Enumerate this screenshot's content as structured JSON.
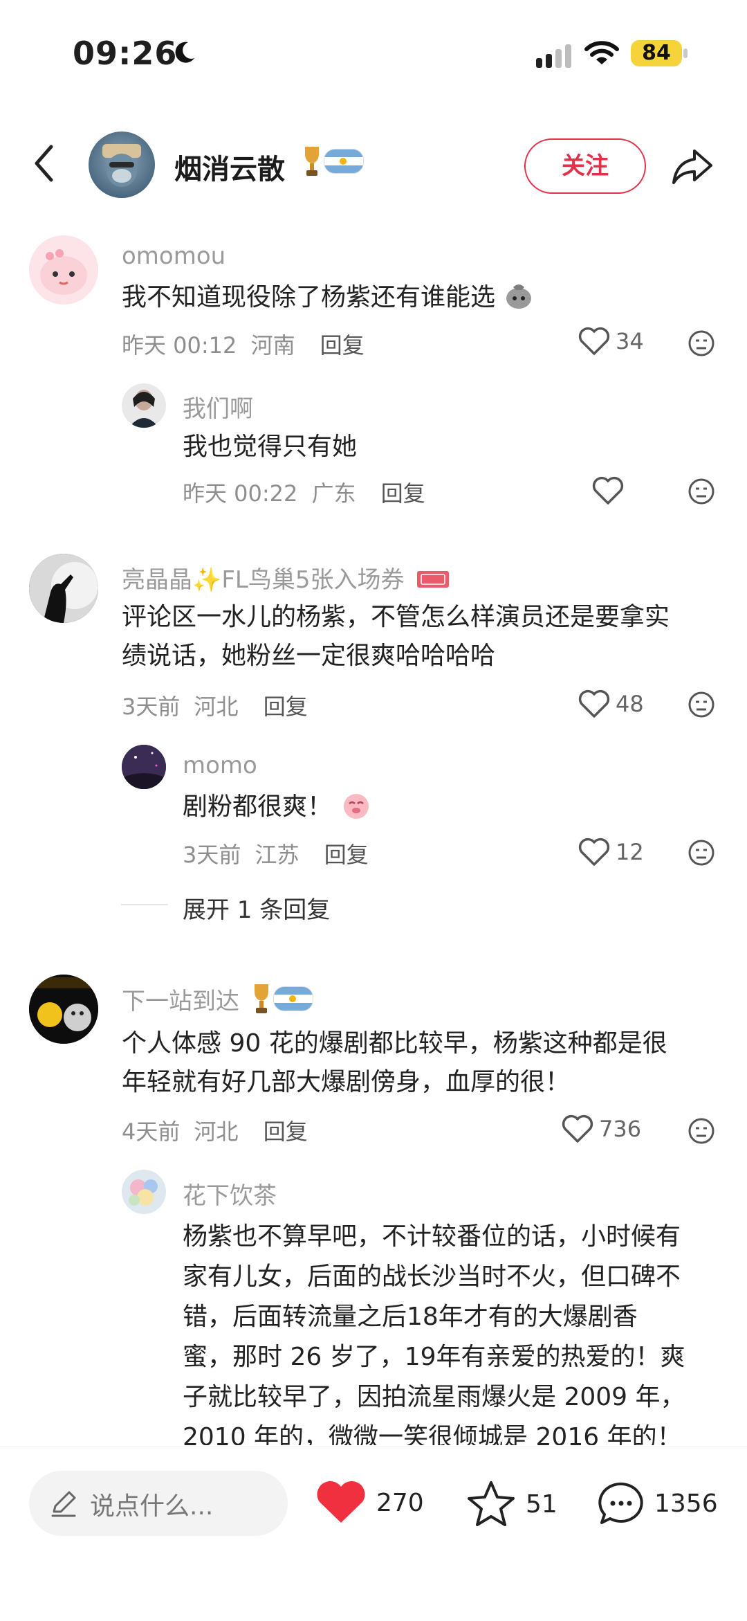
{
  "status": {
    "time": "09:26",
    "battery": "84"
  },
  "header": {
    "name": "烟消云散",
    "follow_label": "关注"
  },
  "comments": [
    {
      "user": "omomou",
      "text": "我不知道现役除了杨紫还有谁能选",
      "time": "昨天 00:12",
      "loc": "河南",
      "reply_label": "回复",
      "likes": "34",
      "replies": [
        {
          "user": "我们啊",
          "text": "我也觉得只有她",
          "time": "昨天 00:22",
          "loc": "广东",
          "reply_label": "回复",
          "likes": ""
        }
      ]
    },
    {
      "user": "亮晶晶✨FL鸟巢5张入场券",
      "text_line1": "评论区一水儿的杨紫，不管怎么样演员还是要拿实",
      "text_line2": "绩说话，她粉丝一定很爽哈哈哈哈",
      "time": "3天前",
      "loc": "河北",
      "reply_label": "回复",
      "likes": "48",
      "replies": [
        {
          "user": "momo",
          "text": "剧粉都很爽！",
          "time": "3天前",
          "loc": "江苏",
          "reply_label": "回复",
          "likes": "12"
        }
      ],
      "expand_label": "展开 1 条回复"
    },
    {
      "user": "下一站到达",
      "text_line1": "个人体感 90 花的爆剧都比较早，杨紫这种都是很",
      "text_line2": "年轻就有好几部大爆剧傍身，血厚的很！",
      "time": "4天前",
      "loc": "河北",
      "reply_label": "回复",
      "likes": "736",
      "replies": [
        {
          "user": "花下饮茶",
          "lines": [
            "杨紫也不算早吧，不计较番位的话，小时候有",
            "家有儿女，后面的战长沙当时不火，但口碑不",
            "错，后面转流量之后18年才有的大爆剧香",
            "蜜，那时 26 岁了，19年有亲爱的热爱的！爽",
            "子就比较早了，因拍流星雨爆火是 2009 年，",
            "2010 年的，微微一笑很倾城是 2016 年的！"
          ]
        }
      ]
    }
  ],
  "bottom": {
    "placeholder": "说点什么...",
    "likes": "270",
    "stars": "51",
    "comments": "1356"
  },
  "colors": {
    "accent": "#e2324a",
    "like_red": "#f0303f"
  }
}
